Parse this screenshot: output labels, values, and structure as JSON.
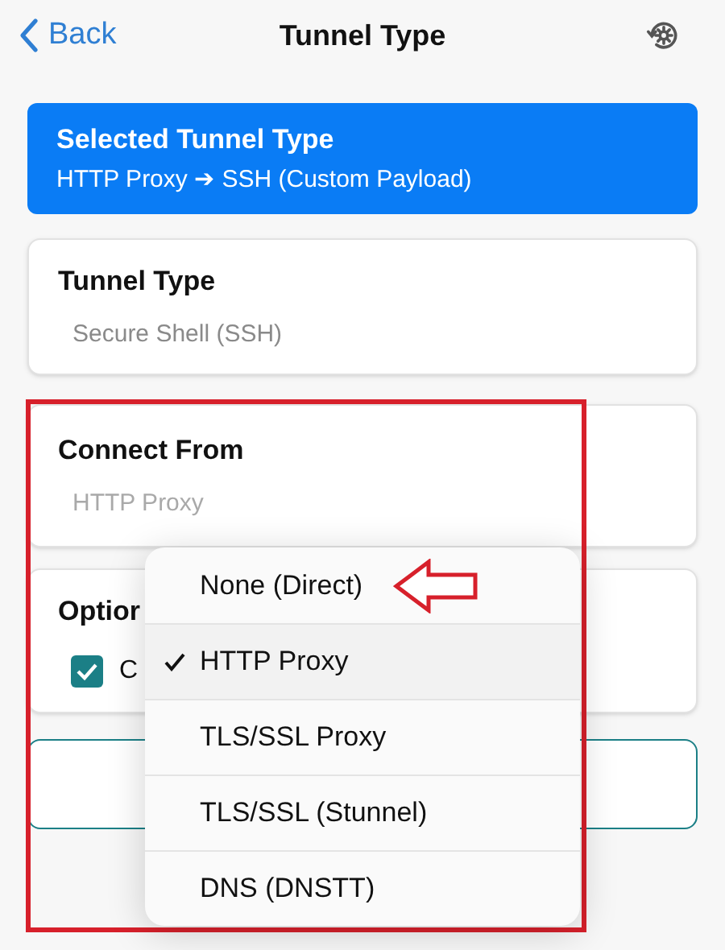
{
  "header": {
    "back": "Back",
    "title": "Tunnel Type"
  },
  "selected_card": {
    "title": "Selected Tunnel Type",
    "value": "HTTP Proxy ➔ SSH (Custom Payload)"
  },
  "tunnel_type": {
    "label": "Tunnel Type",
    "value": "Secure Shell (SSH)"
  },
  "connect_from": {
    "label": "Connect From",
    "value": "HTTP Proxy"
  },
  "options": {
    "label": "Optior",
    "checkbox": {
      "label": "C",
      "checked": true
    }
  },
  "menu": {
    "items": [
      {
        "label": "None (Direct)",
        "selected": false
      },
      {
        "label": "HTTP Proxy",
        "selected": true
      },
      {
        "label": "TLS/SSL Proxy",
        "selected": false
      },
      {
        "label": "TLS/SSL (Stunnel)",
        "selected": false
      },
      {
        "label": "DNS (DNSTT)",
        "selected": false
      }
    ]
  }
}
